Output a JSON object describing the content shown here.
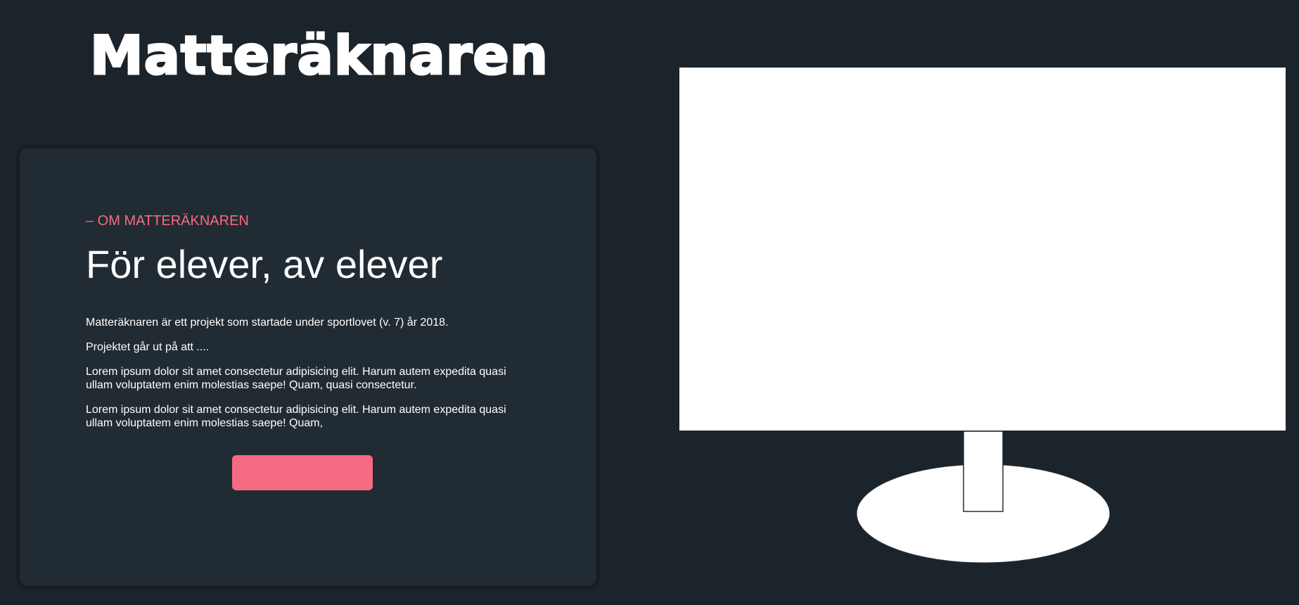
{
  "header": {
    "title": "Matteräknaren"
  },
  "about": {
    "eyebrow": "– OM MATTERÄKNAREN",
    "heading": "För elever, av elever",
    "paragraphs": [
      "Matteräknaren är ett projekt som startade under sportlovet (v. 7) år 2018.",
      "Projektet går ut på att ....",
      "Lorem ipsum dolor sit amet consectetur adipisicing elit. Harum autem expedita quasi ullam voluptatem enim molestias saepe! Quam, quasi consectetur.",
      "Lorem ipsum dolor sit amet consectetur adipisicing elit. Harum autem expedita quasi ullam voluptatem enim molestias saepe! Quam,"
    ],
    "button_label": ""
  },
  "colors": {
    "background": "#1b232b",
    "card": "#212b33",
    "accent": "#f76b82",
    "text": "#ffffff"
  },
  "illustration": {
    "icon": "monitor-icon"
  }
}
